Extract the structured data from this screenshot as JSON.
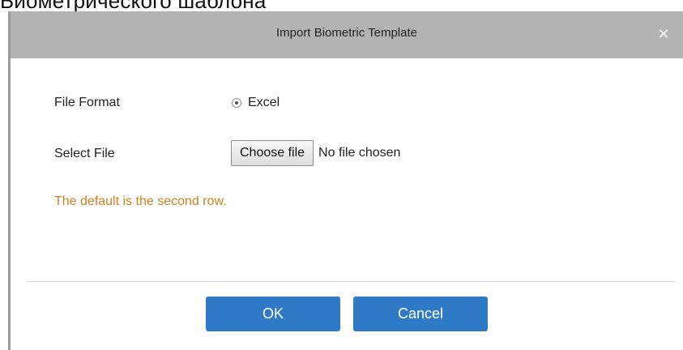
{
  "background": {
    "text": "Биометрического шаблона"
  },
  "dialog": {
    "title": "Import Biometric Template",
    "close_icon": "close-icon",
    "close_glyph": "✕",
    "file_format_label": "File Format",
    "file_format_option": "Excel",
    "select_file_label": "Select File",
    "choose_file_label": "Choose file",
    "no_file_text": "No file chosen",
    "hint": "The default is the second row.",
    "ok_label": "OK",
    "cancel_label": "Cancel",
    "colors": {
      "titlebar": "#b3b3b3",
      "hint": "#d2801f",
      "button": "#2f7ac6"
    }
  }
}
